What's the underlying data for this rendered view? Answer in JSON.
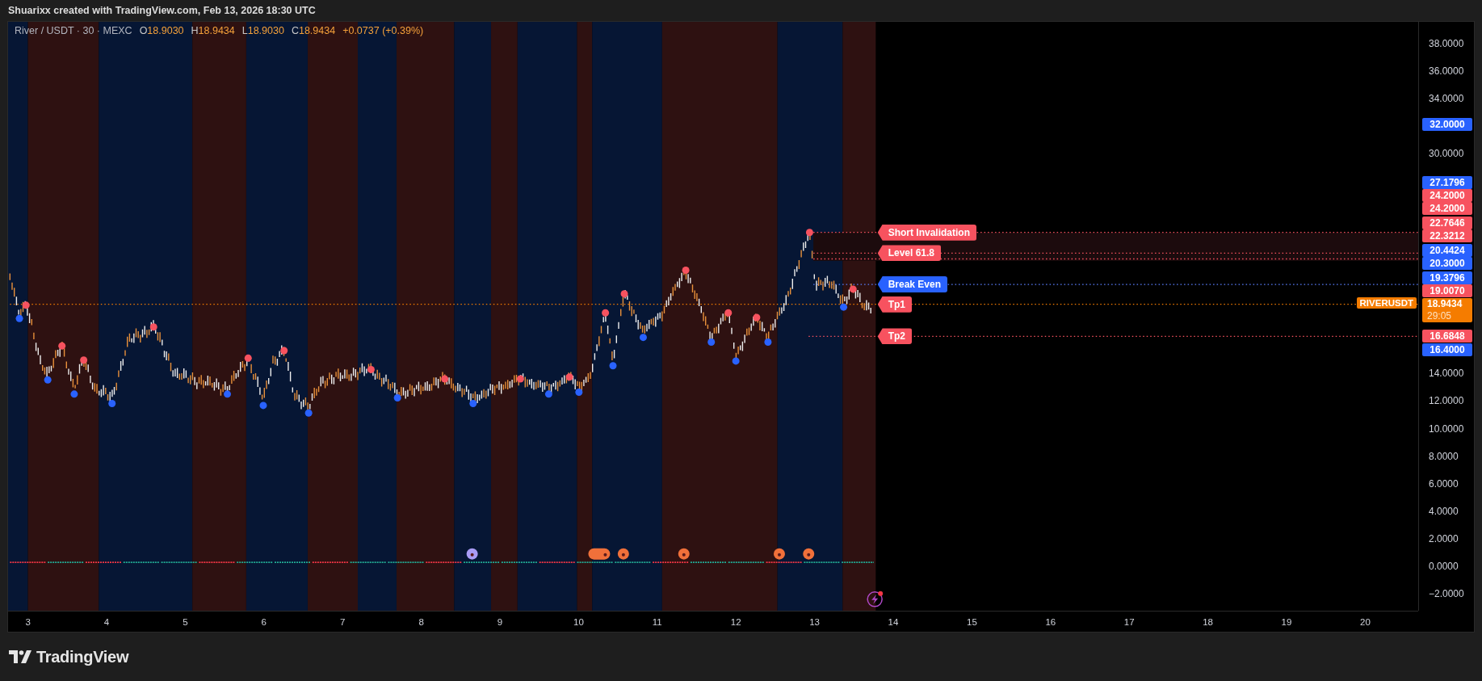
{
  "header": {
    "text": "Shuarixx created with TradingView.com, Feb 13, 2026 18:30 UTC"
  },
  "legend": {
    "symbol": "River / USDT · 30 · MEXC",
    "ohlc": [
      {
        "label": "O",
        "value": "18.9030"
      },
      {
        "label": "H",
        "value": "18.9434"
      },
      {
        "label": "L",
        "value": "18.9030"
      },
      {
        "label": "C",
        "value": "18.9434"
      }
    ],
    "change": "+0.0737 (+0.39%)"
  },
  "chart_labels": [
    {
      "text": "Short Invalidation",
      "color": "#f7525f"
    },
    {
      "text": "Level 61.8",
      "color": "#f7525f"
    },
    {
      "text": "Break Even",
      "color": "#2962ff"
    },
    {
      "text": "Tp1",
      "color": "#f7525f"
    },
    {
      "text": "Tp2",
      "color": "#f7525f"
    }
  ],
  "symbol_tag": "RIVERUSDT",
  "price_axis": {
    "ticks": [
      "38.0000",
      "36.0000",
      "34.0000",
      "30.0000",
      "14.0000",
      "12.0000",
      "10.0000",
      "8.0000",
      "6.0000",
      "4.0000",
      "2.0000",
      "0.0000",
      "−2.0000"
    ],
    "tags": [
      {
        "text": "32.0000",
        "color": "#2962ff"
      },
      {
        "text": "27.1796",
        "color": "#2962ff"
      },
      {
        "text": "24.2000",
        "color": "#f7525f"
      },
      {
        "text": "24.2000",
        "color": "#f7525f"
      },
      {
        "text": "22.7646",
        "color": "#f7525f"
      },
      {
        "text": "22.3212",
        "color": "#f7525f"
      },
      {
        "text": "20.4424",
        "color": "#2962ff"
      },
      {
        "text": "20.3000",
        "color": "#2962ff"
      },
      {
        "text": "19.3796",
        "color": "#2962ff"
      },
      {
        "text": "19.0070",
        "color": "#f7525f"
      },
      {
        "text": "18.9434",
        "color": "#f57c00",
        "countdown": "29:05"
      },
      {
        "text": "16.6848",
        "color": "#f7525f"
      },
      {
        "text": "16.4000",
        "color": "#2962ff"
      }
    ]
  },
  "time_axis": [
    "3",
    "4",
    "5",
    "6",
    "7",
    "8",
    "9",
    "10",
    "11",
    "12",
    "13",
    "14",
    "15",
    "16",
    "17",
    "18",
    "19",
    "20"
  ],
  "brand": "TradingView"
}
